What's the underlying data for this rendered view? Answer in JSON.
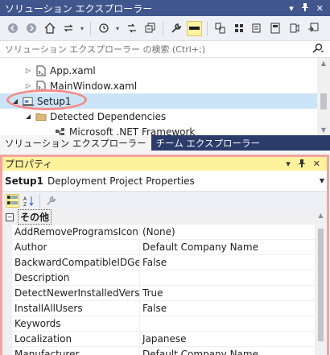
{
  "solution_explorer": {
    "title": "ソリューション エクスプローラー",
    "search_placeholder": "ソリューション エクスプローラー の検索 (Ctrl+;)",
    "tree": [
      {
        "label": "App.xaml"
      },
      {
        "label": "MainWindow.xaml"
      },
      {
        "label": "Setup1"
      },
      {
        "label": "Detected Dependencies"
      },
      {
        "label": "Microsoft .NET Framework"
      }
    ]
  },
  "tabs": {
    "solution_explorer": "ソリューション エクスプローラー",
    "team_explorer": "チーム エクスプローラー"
  },
  "properties": {
    "title": "プロパティ",
    "object_name": "Setup1",
    "object_type": "Deployment Project Properties",
    "category": "その他",
    "rows": [
      {
        "name": "AddRemoveProgramsIcon",
        "value": "(None)"
      },
      {
        "name": "Author",
        "value": "Default Company Name"
      },
      {
        "name": "BackwardCompatibleIDGeneration",
        "value": "False"
      },
      {
        "name": "Description",
        "value": ""
      },
      {
        "name": "DetectNewerInstalledVersion",
        "value": "True"
      },
      {
        "name": "InstallAllUsers",
        "value": "False"
      },
      {
        "name": "Keywords",
        "value": ""
      },
      {
        "name": "Localization",
        "value": "Japanese"
      },
      {
        "name": "Manufacturer",
        "value": "Default Company Name"
      }
    ]
  },
  "colors": {
    "title_bar": "#40568d",
    "properties_title_active": "#fff29d",
    "tab_strip": "#2b3c6b",
    "selection": "#cce4f7",
    "annotation": "#f48b8b"
  },
  "icons": {
    "back": "back-icon",
    "forward": "forward-icon",
    "home": "home-icon",
    "sync": "sync-icon",
    "history": "history-icon",
    "pending_changes": "pending-changes-icon",
    "collapse": "collapse-all-icon",
    "properties": "wrench-icon",
    "preview": "preview-icon",
    "categorized": "categorized-icon",
    "alphabetical": "alphabetical-icon",
    "search": "search-icon"
  }
}
